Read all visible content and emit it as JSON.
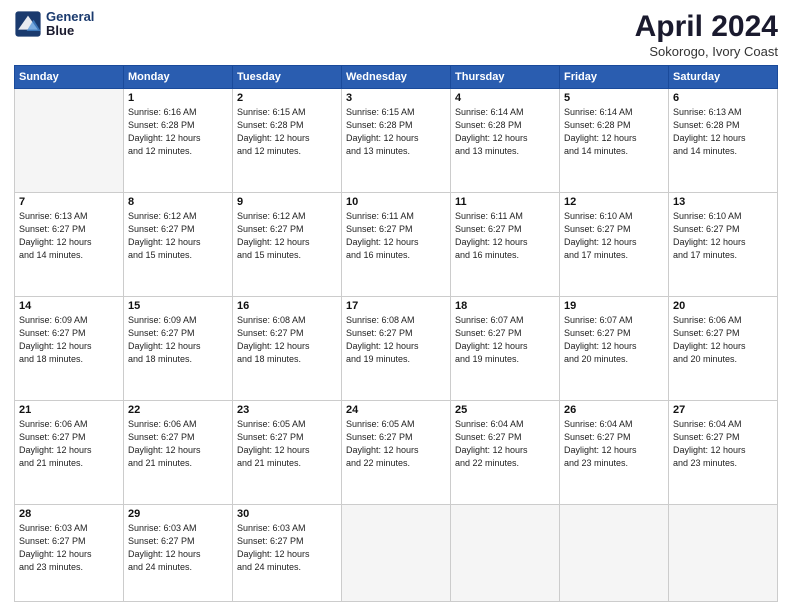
{
  "header": {
    "logo_line1": "General",
    "logo_line2": "Blue",
    "month_year": "April 2024",
    "location": "Sokorogo, Ivory Coast"
  },
  "days_of_week": [
    "Sunday",
    "Monday",
    "Tuesday",
    "Wednesday",
    "Thursday",
    "Friday",
    "Saturday"
  ],
  "weeks": [
    [
      {
        "day": "",
        "info": ""
      },
      {
        "day": "1",
        "info": "Sunrise: 6:16 AM\nSunset: 6:28 PM\nDaylight: 12 hours\nand 12 minutes."
      },
      {
        "day": "2",
        "info": "Sunrise: 6:15 AM\nSunset: 6:28 PM\nDaylight: 12 hours\nand 12 minutes."
      },
      {
        "day": "3",
        "info": "Sunrise: 6:15 AM\nSunset: 6:28 PM\nDaylight: 12 hours\nand 13 minutes."
      },
      {
        "day": "4",
        "info": "Sunrise: 6:14 AM\nSunset: 6:28 PM\nDaylight: 12 hours\nand 13 minutes."
      },
      {
        "day": "5",
        "info": "Sunrise: 6:14 AM\nSunset: 6:28 PM\nDaylight: 12 hours\nand 14 minutes."
      },
      {
        "day": "6",
        "info": "Sunrise: 6:13 AM\nSunset: 6:28 PM\nDaylight: 12 hours\nand 14 minutes."
      }
    ],
    [
      {
        "day": "7",
        "info": "Sunrise: 6:13 AM\nSunset: 6:27 PM\nDaylight: 12 hours\nand 14 minutes."
      },
      {
        "day": "8",
        "info": "Sunrise: 6:12 AM\nSunset: 6:27 PM\nDaylight: 12 hours\nand 15 minutes."
      },
      {
        "day": "9",
        "info": "Sunrise: 6:12 AM\nSunset: 6:27 PM\nDaylight: 12 hours\nand 15 minutes."
      },
      {
        "day": "10",
        "info": "Sunrise: 6:11 AM\nSunset: 6:27 PM\nDaylight: 12 hours\nand 16 minutes."
      },
      {
        "day": "11",
        "info": "Sunrise: 6:11 AM\nSunset: 6:27 PM\nDaylight: 12 hours\nand 16 minutes."
      },
      {
        "day": "12",
        "info": "Sunrise: 6:10 AM\nSunset: 6:27 PM\nDaylight: 12 hours\nand 17 minutes."
      },
      {
        "day": "13",
        "info": "Sunrise: 6:10 AM\nSunset: 6:27 PM\nDaylight: 12 hours\nand 17 minutes."
      }
    ],
    [
      {
        "day": "14",
        "info": "Sunrise: 6:09 AM\nSunset: 6:27 PM\nDaylight: 12 hours\nand 18 minutes."
      },
      {
        "day": "15",
        "info": "Sunrise: 6:09 AM\nSunset: 6:27 PM\nDaylight: 12 hours\nand 18 minutes."
      },
      {
        "day": "16",
        "info": "Sunrise: 6:08 AM\nSunset: 6:27 PM\nDaylight: 12 hours\nand 18 minutes."
      },
      {
        "day": "17",
        "info": "Sunrise: 6:08 AM\nSunset: 6:27 PM\nDaylight: 12 hours\nand 19 minutes."
      },
      {
        "day": "18",
        "info": "Sunrise: 6:07 AM\nSunset: 6:27 PM\nDaylight: 12 hours\nand 19 minutes."
      },
      {
        "day": "19",
        "info": "Sunrise: 6:07 AM\nSunset: 6:27 PM\nDaylight: 12 hours\nand 20 minutes."
      },
      {
        "day": "20",
        "info": "Sunrise: 6:06 AM\nSunset: 6:27 PM\nDaylight: 12 hours\nand 20 minutes."
      }
    ],
    [
      {
        "day": "21",
        "info": "Sunrise: 6:06 AM\nSunset: 6:27 PM\nDaylight: 12 hours\nand 21 minutes."
      },
      {
        "day": "22",
        "info": "Sunrise: 6:06 AM\nSunset: 6:27 PM\nDaylight: 12 hours\nand 21 minutes."
      },
      {
        "day": "23",
        "info": "Sunrise: 6:05 AM\nSunset: 6:27 PM\nDaylight: 12 hours\nand 21 minutes."
      },
      {
        "day": "24",
        "info": "Sunrise: 6:05 AM\nSunset: 6:27 PM\nDaylight: 12 hours\nand 22 minutes."
      },
      {
        "day": "25",
        "info": "Sunrise: 6:04 AM\nSunset: 6:27 PM\nDaylight: 12 hours\nand 22 minutes."
      },
      {
        "day": "26",
        "info": "Sunrise: 6:04 AM\nSunset: 6:27 PM\nDaylight: 12 hours\nand 23 minutes."
      },
      {
        "day": "27",
        "info": "Sunrise: 6:04 AM\nSunset: 6:27 PM\nDaylight: 12 hours\nand 23 minutes."
      }
    ],
    [
      {
        "day": "28",
        "info": "Sunrise: 6:03 AM\nSunset: 6:27 PM\nDaylight: 12 hours\nand 23 minutes."
      },
      {
        "day": "29",
        "info": "Sunrise: 6:03 AM\nSunset: 6:27 PM\nDaylight: 12 hours\nand 24 minutes."
      },
      {
        "day": "30",
        "info": "Sunrise: 6:03 AM\nSunset: 6:27 PM\nDaylight: 12 hours\nand 24 minutes."
      },
      {
        "day": "",
        "info": ""
      },
      {
        "day": "",
        "info": ""
      },
      {
        "day": "",
        "info": ""
      },
      {
        "day": "",
        "info": ""
      }
    ]
  ]
}
